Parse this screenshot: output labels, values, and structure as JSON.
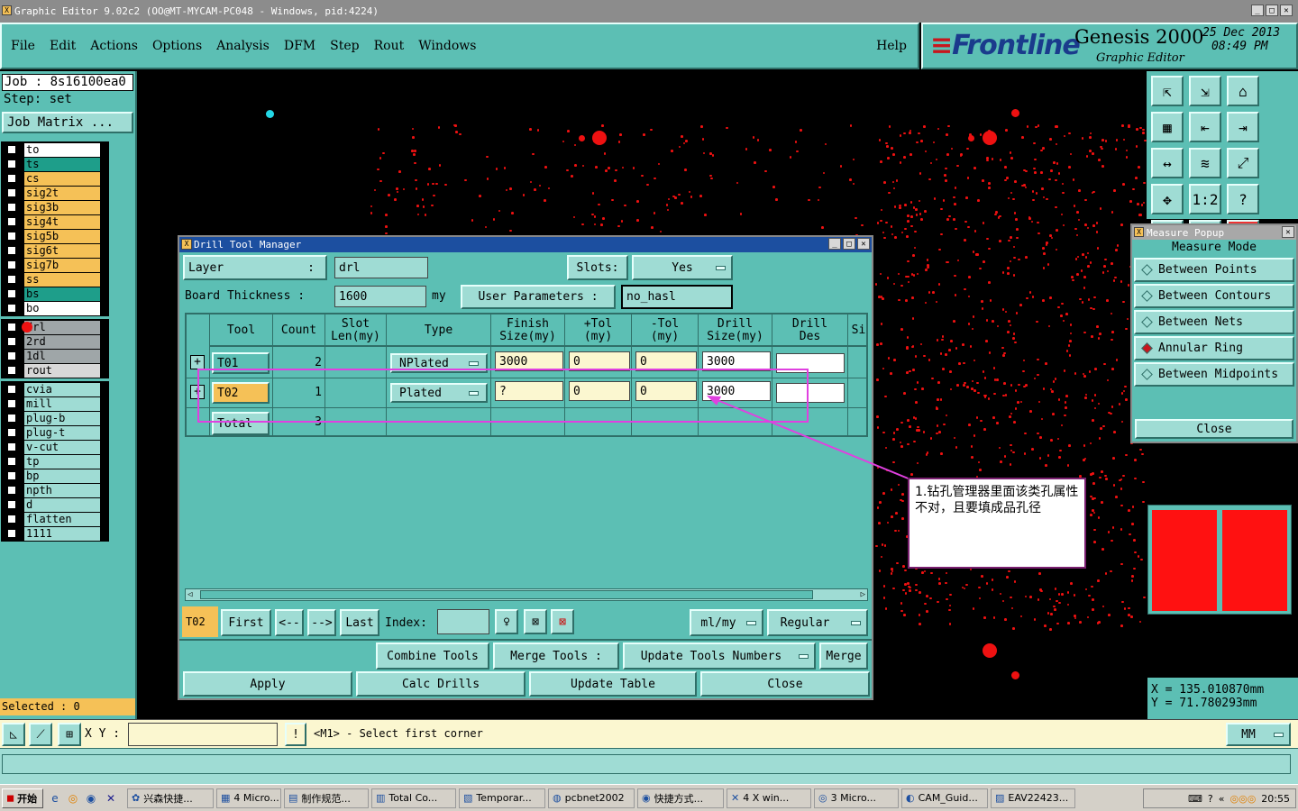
{
  "window": {
    "title": "Graphic Editor 9.02c2 (OO@MT-MYCAM-PC048 - Windows, pid:4224)"
  },
  "menu": {
    "items": [
      "File",
      "Edit",
      "Actions",
      "Options",
      "Analysis",
      "DFM",
      "Step",
      "Rout",
      "Windows"
    ],
    "help": "Help"
  },
  "brand": {
    "logo": "Frontline",
    "product": "Genesis 2000",
    "subtitle": "Graphic Editor",
    "date": "25 Dec 2013",
    "time": "08:49 PM"
  },
  "job": {
    "job_label": "Job : 8s16100ea0",
    "step_label": "Step: set",
    "matrix_button": "Job Matrix ..."
  },
  "layers": {
    "board": [
      {
        "name": "to",
        "color": "#ffffff"
      },
      {
        "name": "ts",
        "color": "#1e9e8a"
      },
      {
        "name": "cs",
        "color": "#f5c157"
      },
      {
        "name": "sig2t",
        "color": "#f5c157"
      },
      {
        "name": "sig3b",
        "color": "#f5c157"
      },
      {
        "name": "sig4t",
        "color": "#f5c157"
      },
      {
        "name": "sig5b",
        "color": "#f5c157"
      },
      {
        "name": "sig6t",
        "color": "#f5c157"
      },
      {
        "name": "sig7b",
        "color": "#f5c157"
      },
      {
        "name": "ss",
        "color": "#f5c157"
      },
      {
        "name": "bs",
        "color": "#1e9e8a"
      },
      {
        "name": "bo",
        "color": "#ffffff"
      }
    ],
    "drill": [
      {
        "name": "drl",
        "color": "#9fa6a8"
      },
      {
        "name": "2rd",
        "color": "#9fa6a8"
      },
      {
        "name": "1dl",
        "color": "#9fa6a8"
      },
      {
        "name": "rout",
        "color": "#d8d8d8"
      }
    ],
    "misc": [
      {
        "name": "cvia"
      },
      {
        "name": "mill"
      },
      {
        "name": "plug-b"
      },
      {
        "name": "plug-t"
      },
      {
        "name": "v-cut"
      },
      {
        "name": "tp"
      },
      {
        "name": "bp"
      },
      {
        "name": "npth"
      },
      {
        "name": "d"
      },
      {
        "name": "flatten"
      },
      {
        "name": "1111"
      }
    ],
    "selected": "Selected : 0"
  },
  "dtm": {
    "title": "Drill Tool Manager",
    "layer_label": "Layer",
    "layer_colon": ":",
    "layer_value": "drl",
    "slots_label": "Slots:",
    "slots_value": "Yes",
    "thickness_label": "Board Thickness :",
    "thickness_value": "1600",
    "thickness_unit": "my",
    "user_params_label": "User Parameters :",
    "user_params_value": "no_hasl",
    "columns": [
      "Tool",
      "Count",
      "Slot\nLen(my)",
      "Type",
      "Finish\nSize(my)",
      "+Tol\n(my)",
      "-Tol\n(my)",
      "Drill\nSize(my)",
      "Drill\nDes",
      "Si"
    ],
    "rows": [
      {
        "tool": "T01",
        "count": "2",
        "type": "NPlated",
        "finish": "3000",
        "ptol": "0",
        "mtol": "0",
        "drill": "3000",
        "des": ""
      },
      {
        "tool": "T02",
        "count": "1",
        "type": "Plated",
        "finish": "?",
        "ptol": "0",
        "mtol": "0",
        "drill": "3000",
        "des": ""
      }
    ],
    "total_label": "Total",
    "total_count": "3",
    "current_tool": "T02",
    "nav": {
      "first": "First",
      "prev": "<--",
      "next": "-->",
      "last": "Last",
      "index_label": "Index:"
    },
    "units_value": "ml/my",
    "mode_value": "Regular",
    "combine": "Combine Tools",
    "merge_tools": "Merge Tools :",
    "update_numbers": "Update Tools Numbers",
    "merge": "Merge",
    "apply": "Apply",
    "calc": "Calc Drills",
    "update_table": "Update Table",
    "close": "Close"
  },
  "annotation": {
    "text": "1.钻孔管理器里面该类孔属性不对，且要填成品孔径"
  },
  "measure": {
    "title": "Measure Popup",
    "mode_label": "Measure Mode",
    "options": [
      {
        "label": "Between Points",
        "selected": false
      },
      {
        "label": "Between Contours",
        "selected": false
      },
      {
        "label": "Between Nets",
        "selected": false
      },
      {
        "label": "Annular Ring",
        "selected": true
      },
      {
        "label": "Between Midpoints",
        "selected": false
      }
    ],
    "close": "Close"
  },
  "coords": {
    "x": "X  =  135.010870mm",
    "y": "Y  =  71.780293mm"
  },
  "status": {
    "xy_label": "X Y :",
    "message": "<M1> - Select first corner",
    "units": "MM"
  },
  "toolbar_icons": [
    "zoom-home-icon",
    "zoom-window-icon",
    "zoom-back-icon",
    "grid-icon",
    "move-left-icon",
    "move-right-icon",
    "pan-icon",
    "snap-icon",
    "fit-icon",
    "center-icon",
    "one-to-one-icon",
    "help-icon",
    "filter-icon",
    "grid-view-icon",
    "drill-map-icon",
    "drill-check-icon"
  ],
  "taskbar": {
    "start": "开始",
    "items": [
      "兴森快捷...",
      "4 Micro...",
      "制作规范...",
      "Total Co...",
      "Temporar...",
      "pcbnet2002",
      "快捷方式...",
      "4 X win...",
      "3 Micro...",
      "CAM_Guid...",
      "EAV22423..."
    ],
    "clock": "20:55"
  },
  "colors": {
    "teal": "#5cbfb4",
    "light_teal": "#9fdcd4",
    "canvas": "#000000",
    "dot": "#e11111",
    "highlight": "#e040e0"
  }
}
